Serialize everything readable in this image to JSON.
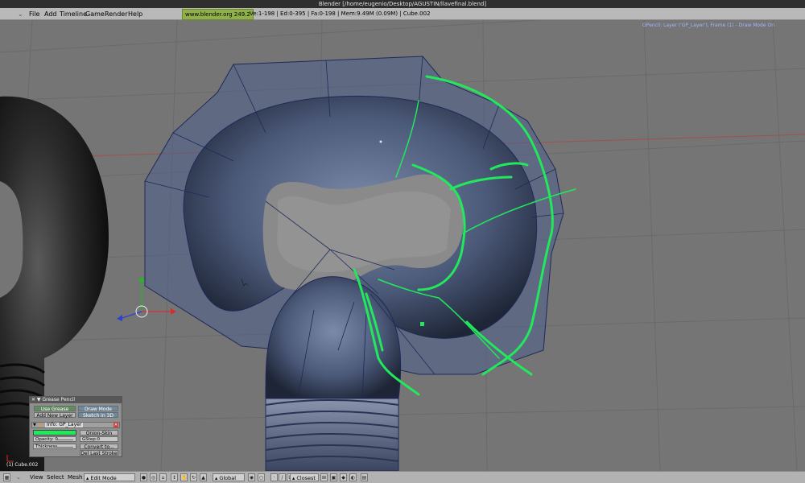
{
  "window": {
    "title": "Blender [/home/eugenio/Desktop/AGUSTIN/llavefinal.blend]"
  },
  "menubar": {
    "items": [
      "File",
      "Add",
      "Timeline",
      "Game",
      "Render",
      "Help"
    ],
    "url_badge": "www.blender.org 249.2",
    "stats": "Ve:1-198 | Ed:0-395 | Fa:0-198 | Mem:9.49M (0.09M) | Cube.002"
  },
  "viewport": {
    "gpencil_status": "GPencil: Layer ('GP_Layer'), Frame (1) - Draw Mode On",
    "object_label": "(1) Cube.002"
  },
  "grease_pencil_panel": {
    "title": "Grease Pencil",
    "use_grease_pencil": "Use Grease Pencil",
    "draw_mode": "Draw Mode",
    "add_new_layer": "Add New Layer",
    "sketch_in_3d": "Sketch in 3D",
    "layer_name": "Info: GP_Layer",
    "onion_skin": "Onion-Skin",
    "opacity_label": "Opacity: 0",
    "gstep_label": "GStep:0",
    "thickness_label": "Thickness",
    "convert_to": "Convert to...",
    "del_last_stroke": "Del Last Stroke",
    "stroke_color": "#22e85c"
  },
  "header": {
    "view": "View",
    "select": "Select",
    "mesh": "Mesh",
    "mode": "Edit Mode",
    "orientation": "Global",
    "snap": "Closest"
  },
  "colors": {
    "viewport_bg": "#757575",
    "grease_green": "#22e85c",
    "mesh_wire": "#1e2a5a",
    "mesh_fill": "#4c5f8a"
  }
}
